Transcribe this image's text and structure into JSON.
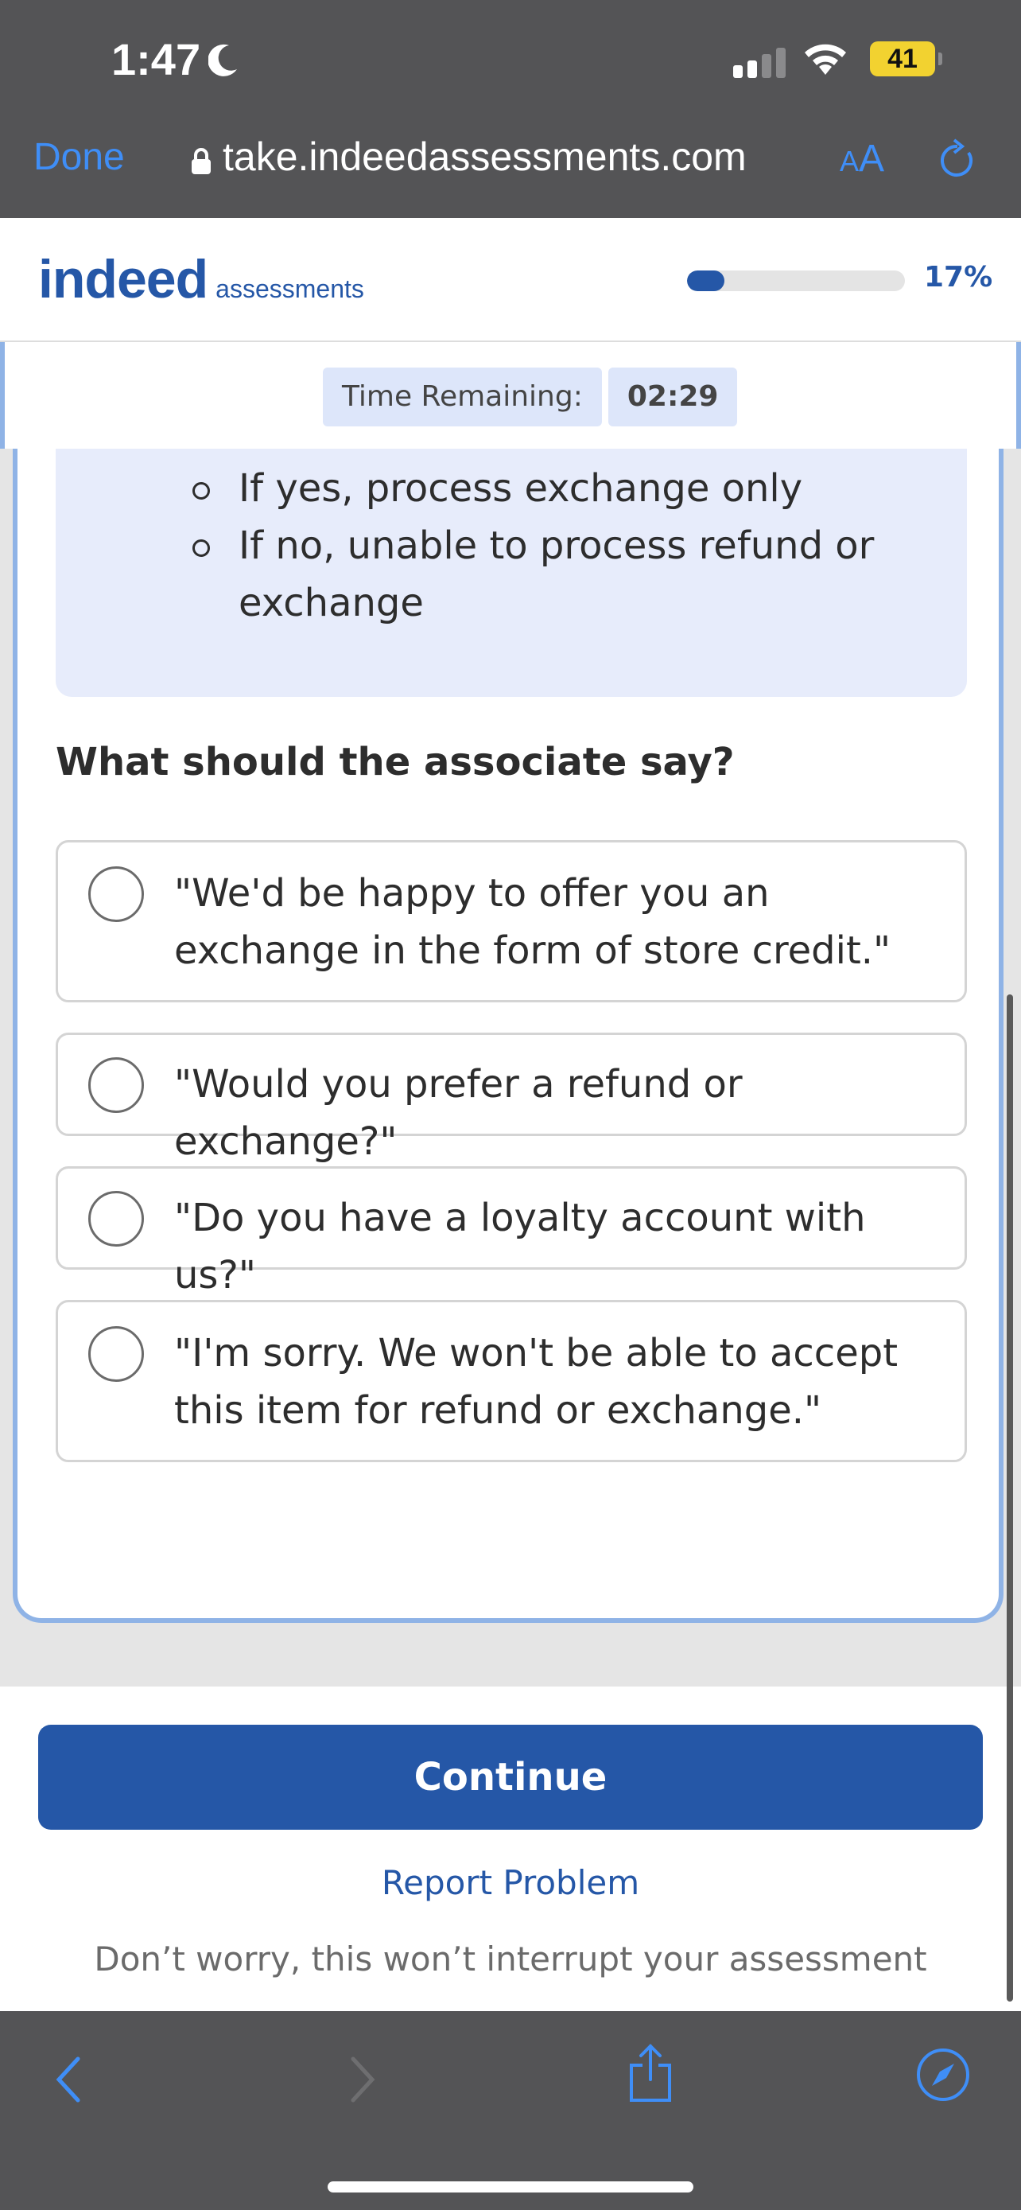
{
  "status_bar": {
    "time": "1:47",
    "battery": "41"
  },
  "browser": {
    "done_label": "Done",
    "url": "take.indeedassessments.com",
    "aa_small": "A",
    "aa_large": "A"
  },
  "app_header": {
    "logo_main": "indeed",
    "logo_sub": "assessments",
    "progress_percent": 17,
    "progress_label": "17%"
  },
  "timer": {
    "label": "Time Remaining:",
    "value": "02:29"
  },
  "info_box": {
    "bullets": [
      "If yes, process exchange only",
      "If no, unable to process refund or exchange"
    ]
  },
  "question": "What should the associate say?",
  "options": [
    "\"We'd be happy to offer you an exchange in the form of store credit.\"",
    "\"Would you prefer a refund or exchange?\"",
    "\"Do you have a loyalty account with us?\"",
    "\"I'm sorry. We won't be able to accept this item for refund or exchange.\""
  ],
  "footer": {
    "continue_label": "Continue",
    "report_label": "Report Problem",
    "reassurance": "Don’t worry, this won’t interrupt your assessment"
  },
  "colors": {
    "brand_blue": "#2557a7",
    "ios_link_blue": "#3f8ef7",
    "chrome_gray": "#545456",
    "info_bg": "#e7ecfb"
  }
}
